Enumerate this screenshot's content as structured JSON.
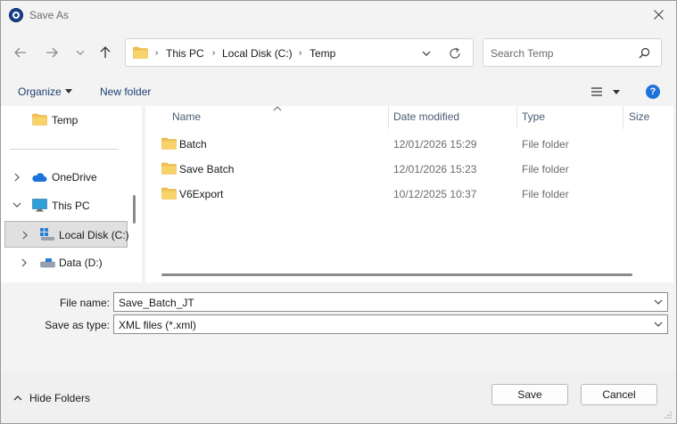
{
  "window": {
    "title": "Save As"
  },
  "address": {
    "crumbs": [
      "This PC",
      "Local Disk (C:)",
      "Temp"
    ]
  },
  "search": {
    "placeholder": "Search Temp"
  },
  "toolbar": {
    "organize_label": "Organize",
    "new_folder_label": "New folder",
    "help_label": "?"
  },
  "sidebar": {
    "items": [
      {
        "label": "Temp",
        "icon": "folder-icon"
      },
      {
        "label": "OneDrive",
        "icon": "onedrive-cloud-icon"
      },
      {
        "label": "This PC",
        "icon": "monitor-icon"
      },
      {
        "label": "Local Disk (C:)",
        "icon": "windows-drive-icon",
        "selected": true
      },
      {
        "label": "Data (D:)",
        "icon": "drive-icon"
      }
    ]
  },
  "files": {
    "columns": [
      "Name",
      "Date modified",
      "Type",
      "Size"
    ],
    "sorted_by": "Name",
    "rows": [
      {
        "name": "Batch",
        "date": "12/01/2026 15:29",
        "type": "File folder",
        "size": ""
      },
      {
        "name": "Save Batch",
        "date": "12/01/2026 15:23",
        "type": "File folder",
        "size": ""
      },
      {
        "name": "V6Export",
        "date": "10/12/2025 10:37",
        "type": "File folder",
        "size": ""
      }
    ]
  },
  "form": {
    "filename_label": "File name:",
    "filename_value": "Save_Batch_JT",
    "filetype_label": "Save as type:",
    "filetype_value": "XML files (*.xml)"
  },
  "footer": {
    "hide_folders_label": "Hide Folders",
    "save_label": "Save",
    "cancel_label": "Cancel"
  },
  "colors": {
    "folder": "#f2c14e",
    "accent": "#1e73d8",
    "link_text": "#1f3f73"
  }
}
